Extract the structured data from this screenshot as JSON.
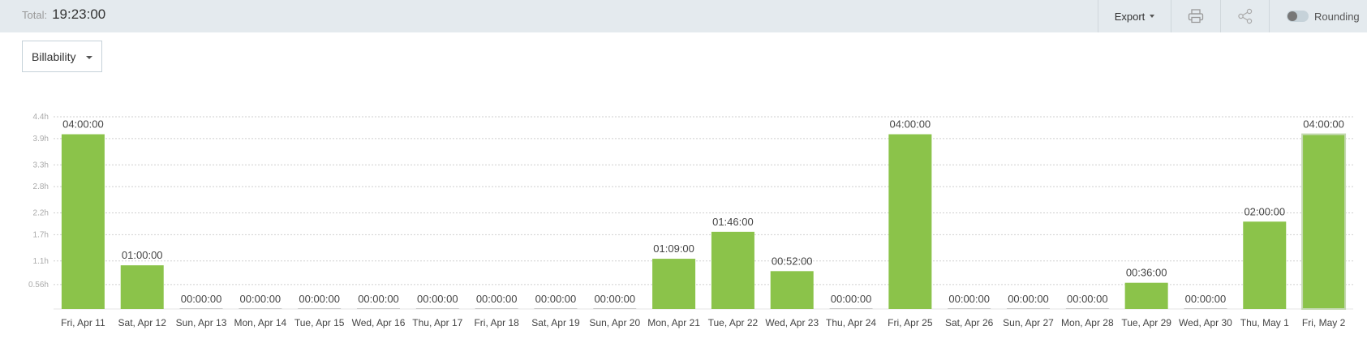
{
  "header": {
    "total_label": "Total:",
    "total_value": "19:23:00",
    "export_label": "Export",
    "rounding_label": "Rounding",
    "rounding_enabled": false
  },
  "filter": {
    "group_by_label": "Billability"
  },
  "colors": {
    "bar": "#8bc34a",
    "bar_selected_border": "#c5d9b3",
    "topbar": "#e4eaee"
  },
  "chart_data": {
    "type": "bar",
    "categories": [
      "Fri, Apr 11",
      "Sat, Apr 12",
      "Sun, Apr 13",
      "Mon, Apr 14",
      "Tue, Apr 15",
      "Wed, Apr 16",
      "Thu, Apr 17",
      "Fri, Apr 18",
      "Sat, Apr 19",
      "Sun, Apr 20",
      "Mon, Apr 21",
      "Tue, Apr 22",
      "Wed, Apr 23",
      "Thu, Apr 24",
      "Fri, Apr 25",
      "Sat, Apr 26",
      "Sun, Apr 27",
      "Mon, Apr 28",
      "Tue, Apr 29",
      "Wed, Apr 30",
      "Thu, May 1",
      "Fri, May 2"
    ],
    "values": [
      4.0,
      1.0,
      0,
      0,
      0,
      0,
      0,
      0,
      0,
      0,
      1.15,
      1.7667,
      0.8667,
      0,
      4.0,
      0,
      0,
      0,
      0.6,
      0,
      2.0,
      4.0
    ],
    "data_labels": [
      "04:00:00",
      "01:00:00",
      "00:00:00",
      "00:00:00",
      "00:00:00",
      "00:00:00",
      "00:00:00",
      "00:00:00",
      "00:00:00",
      "00:00:00",
      "01:09:00",
      "01:46:00",
      "00:52:00",
      "00:00:00",
      "04:00:00",
      "00:00:00",
      "00:00:00",
      "00:00:00",
      "00:36:00",
      "00:00:00",
      "02:00:00",
      "04:00:00"
    ],
    "y_ticks": [
      0.56,
      1.1,
      1.7,
      2.2,
      2.8,
      3.3,
      3.9,
      4.4
    ],
    "y_tick_labels": [
      "0.56h",
      "1.1h",
      "1.7h",
      "2.2h",
      "2.8h",
      "3.3h",
      "3.9h",
      "4.4h"
    ],
    "ylim": [
      0,
      4.4
    ],
    "grid": true,
    "legend": "none",
    "selected_index": 21
  }
}
